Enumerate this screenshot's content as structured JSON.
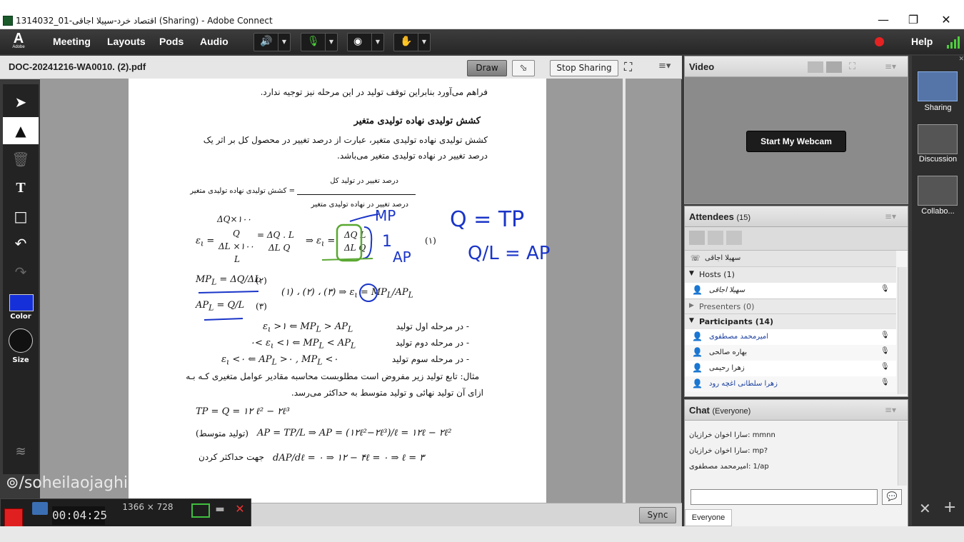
{
  "window": {
    "title": "1314032_01-اقتصاد خرد-سپیلا اجاقی (Sharing) - Adobe Connect",
    "minimize": "—",
    "restore": "❐",
    "close": "✕"
  },
  "menubar": {
    "logo": "A",
    "logo_sub": "Adobe",
    "items": [
      "Meeting",
      "Layouts",
      "Pods",
      "Audio"
    ],
    "help": "Help"
  },
  "share_pod": {
    "filename": "DOC-20241216-WA0010. (2).pdf",
    "draw_label": "Draw",
    "stop_sharing_label": "Stop Sharing",
    "sync_label": "Sync",
    "tools": {
      "color_label": "Color",
      "size_label": "Size",
      "color_value": "#1530d8"
    }
  },
  "document": {
    "line_top": "فراهم می‌آورد بنابراین توقف تولید در این مرحله نیز توجیه ندارد.",
    "heading": "کشش تولیدی نهاده تولیدی متغیر",
    "para1": "کشش تولیدی نهاده تولیدی متغیر، عبارت از درصد تغییر در محصول کل بر اثر یک",
    "para2": "درصد تغییر در نهاده تولیدی متغیر می‌باشد.",
    "frac_label": "= کشش تولیدی نهاده تولیدی متغیر",
    "frac_num": "درصد تغییر در تولید کل",
    "frac_den": "درصد تغییر در نهاده تولیدی متغیر",
    "eq_num1": "(۱)",
    "eq_num2": "(۲)",
    "eq_num3": "(۳)",
    "stage1": "- در مرحله اول تولید",
    "stage2": "- در مرحله دوم تولید",
    "stage3": "- در مرحله سوم تولید",
    "example1": "مثال: تابع تولید زیر مفروض است مطلوبست محاسبه مقادیر عوامل متغیری کـه بـه",
    "example2": "ازای آن تولید نهائی و تولید متوسط به حداکثر می‌رسد.",
    "avg_label": "(تولید متوسط)",
    "max_label": "جهت حداکثر کردن"
  },
  "video_pod": {
    "title": "Video",
    "webcam_button": "Start My Webcam"
  },
  "attendees_pod": {
    "title": "Attendees",
    "count": "(15)",
    "me": "سهیلا اجاقی",
    "hosts_label": "Hosts (1)",
    "host_name": "سهیلا اجاقی",
    "presenters_label": "Presenters (0)",
    "participants_label": "Participants (14)",
    "participants": [
      "امیرمحمد مصطفوی",
      "بهاره صالحی",
      "زهرا رحیمی",
      "زهرا سلطانی اغچه رود"
    ]
  },
  "chat_pod": {
    "title": "Chat",
    "scope": "(Everyone)",
    "messages": [
      {
        "sender": "سارا اخوان خرازیان",
        "text": "mmnn"
      },
      {
        "sender": "سارا اخوان خرازیان",
        "text": "mp?"
      },
      {
        "sender": "امیرمحمد مصطفوی",
        "text": "1/ap"
      }
    ],
    "input_placeholder": "",
    "recipient": "Everyone"
  },
  "layouts": {
    "items": [
      "Sharing",
      "Discussion",
      "Collabo..."
    ]
  },
  "recorder": {
    "watermark": "/soheilaojaghi",
    "timer": "00:04:25",
    "resolution": "1366 × 728"
  }
}
